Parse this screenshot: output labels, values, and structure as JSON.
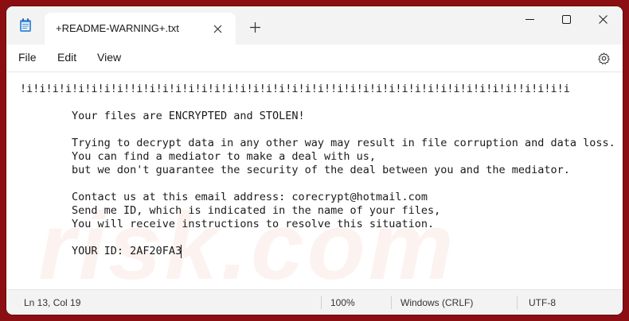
{
  "window": {
    "tab_title": "+README-WARNING+.txt"
  },
  "menu": {
    "file": "File",
    "edit": "Edit",
    "view": "View"
  },
  "document": {
    "lines": [
      "!i!i!i!i!i!i!i!i!!i!i!i!i!i!i!i!i!i!i!i!i!i!i!i!!i!i!i!i!i!i!i!i!i!i!i!i!i!i!!i!i!i!i",
      "",
      "        Your files are ENCRYPTED and STOLEN!",
      "",
      "        Trying to decrypt data in any other way may result in file corruption and data loss.",
      "        You can find a mediator to make a deal with us,",
      "        but we don't guarantee the security of the deal between you and the mediator.",
      "",
      "        Contact us at this email address: corecrypt@hotmail.com",
      "        Send me ID, which is indicated in the name of your files,",
      "        You will receive instructions to resolve this situation.",
      "",
      "        YOUR ID: 2AF20FA3"
    ]
  },
  "status": {
    "position": "Ln 13, Col 19",
    "zoom": "100%",
    "line_ending": "Windows (CRLF)",
    "encoding": "UTF-8"
  },
  "watermark": "risk.com",
  "colors": {
    "background": "#8b0f12",
    "titlebar": "#f3f3f3",
    "text": "#1a1a1a"
  }
}
